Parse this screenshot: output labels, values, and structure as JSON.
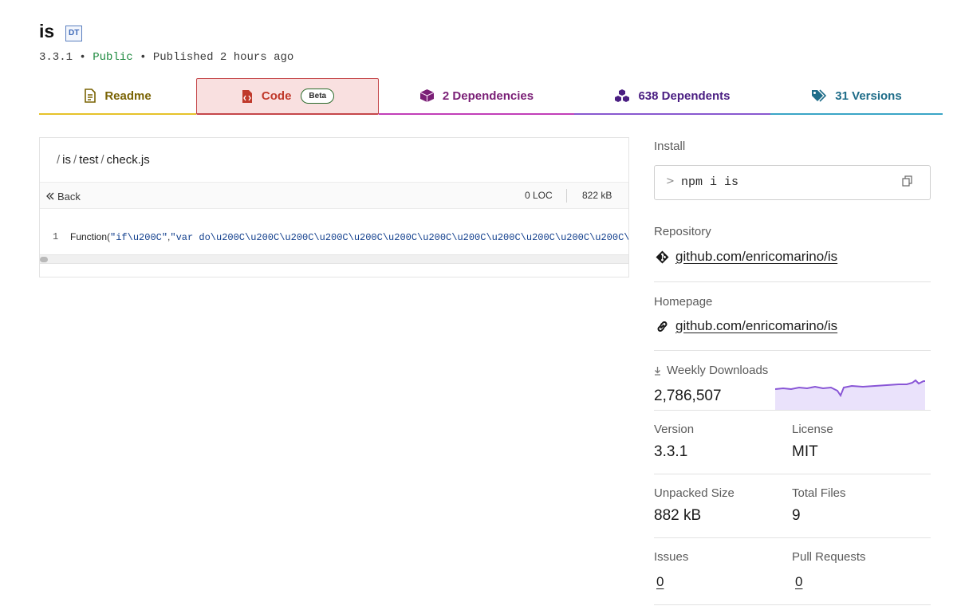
{
  "package": {
    "name": "is",
    "dt_badge": "DT",
    "version": "3.3.1",
    "bullet": "•",
    "visibility": "Public",
    "published": "Published 2 hours ago"
  },
  "tabs": [
    {
      "label": "Readme",
      "icon": "file-icon",
      "color": "#7a6304"
    },
    {
      "label": "Code",
      "badge": "Beta",
      "icon": "code-file-icon",
      "color": "#c0392b"
    },
    {
      "label": "2 Dependencies",
      "icon": "box-icon",
      "color": "#7a1f76"
    },
    {
      "label": "638 Dependents",
      "icon": "boxes-icon",
      "color": "#4a1e82"
    },
    {
      "label": "31 Versions",
      "icon": "tag-icon",
      "color": "#1f6d89"
    }
  ],
  "code_view": {
    "path_parts": [
      "is",
      "test",
      "check.js"
    ],
    "path_sep": "/",
    "back_label": "Back",
    "loc": "0 LOC",
    "size": "822 kB",
    "line_number": "1",
    "code_func": "Function",
    "code_paren": "(",
    "code_arg1": "\"if\\u200C\"",
    "code_comma": ",",
    "code_arg2": "\"var do\\u200C\\u200C\\u200C\\u200C\\u200C\\u200C\\u200C\\u200C\\u200C\\u200C\\u200C\\u200C\\u200C\\u200C\\u200C\\u200C"
  },
  "sidebar": {
    "install_label": "Install",
    "install_prompt": ">",
    "install_cmd": "npm i is",
    "repository_label": "Repository",
    "repository_link": "github.com/enricomarino/is",
    "homepage_label": "Homepage",
    "homepage_link": "github.com/enricomarino/is",
    "weekly_downloads_label": "Weekly Downloads",
    "weekly_downloads": "2,786,507",
    "version_label": "Version",
    "version": "3.3.1",
    "license_label": "License",
    "license": "MIT",
    "unpacked_size_label": "Unpacked Size",
    "unpacked_size": "882 kB",
    "total_files_label": "Total Files",
    "total_files": "9",
    "issues_label": "Issues",
    "issues": "0",
    "pull_requests_label": "Pull Requests",
    "pull_requests": "0"
  },
  "colors": {
    "readme": "#e6c22a",
    "code": "#c5474a",
    "dependencies": "#c13eb8",
    "dependents": "#8958cf",
    "versions": "#3aa5c6",
    "sparkline": "#8956d6",
    "sparkline_fill": "#eae2fb"
  }
}
